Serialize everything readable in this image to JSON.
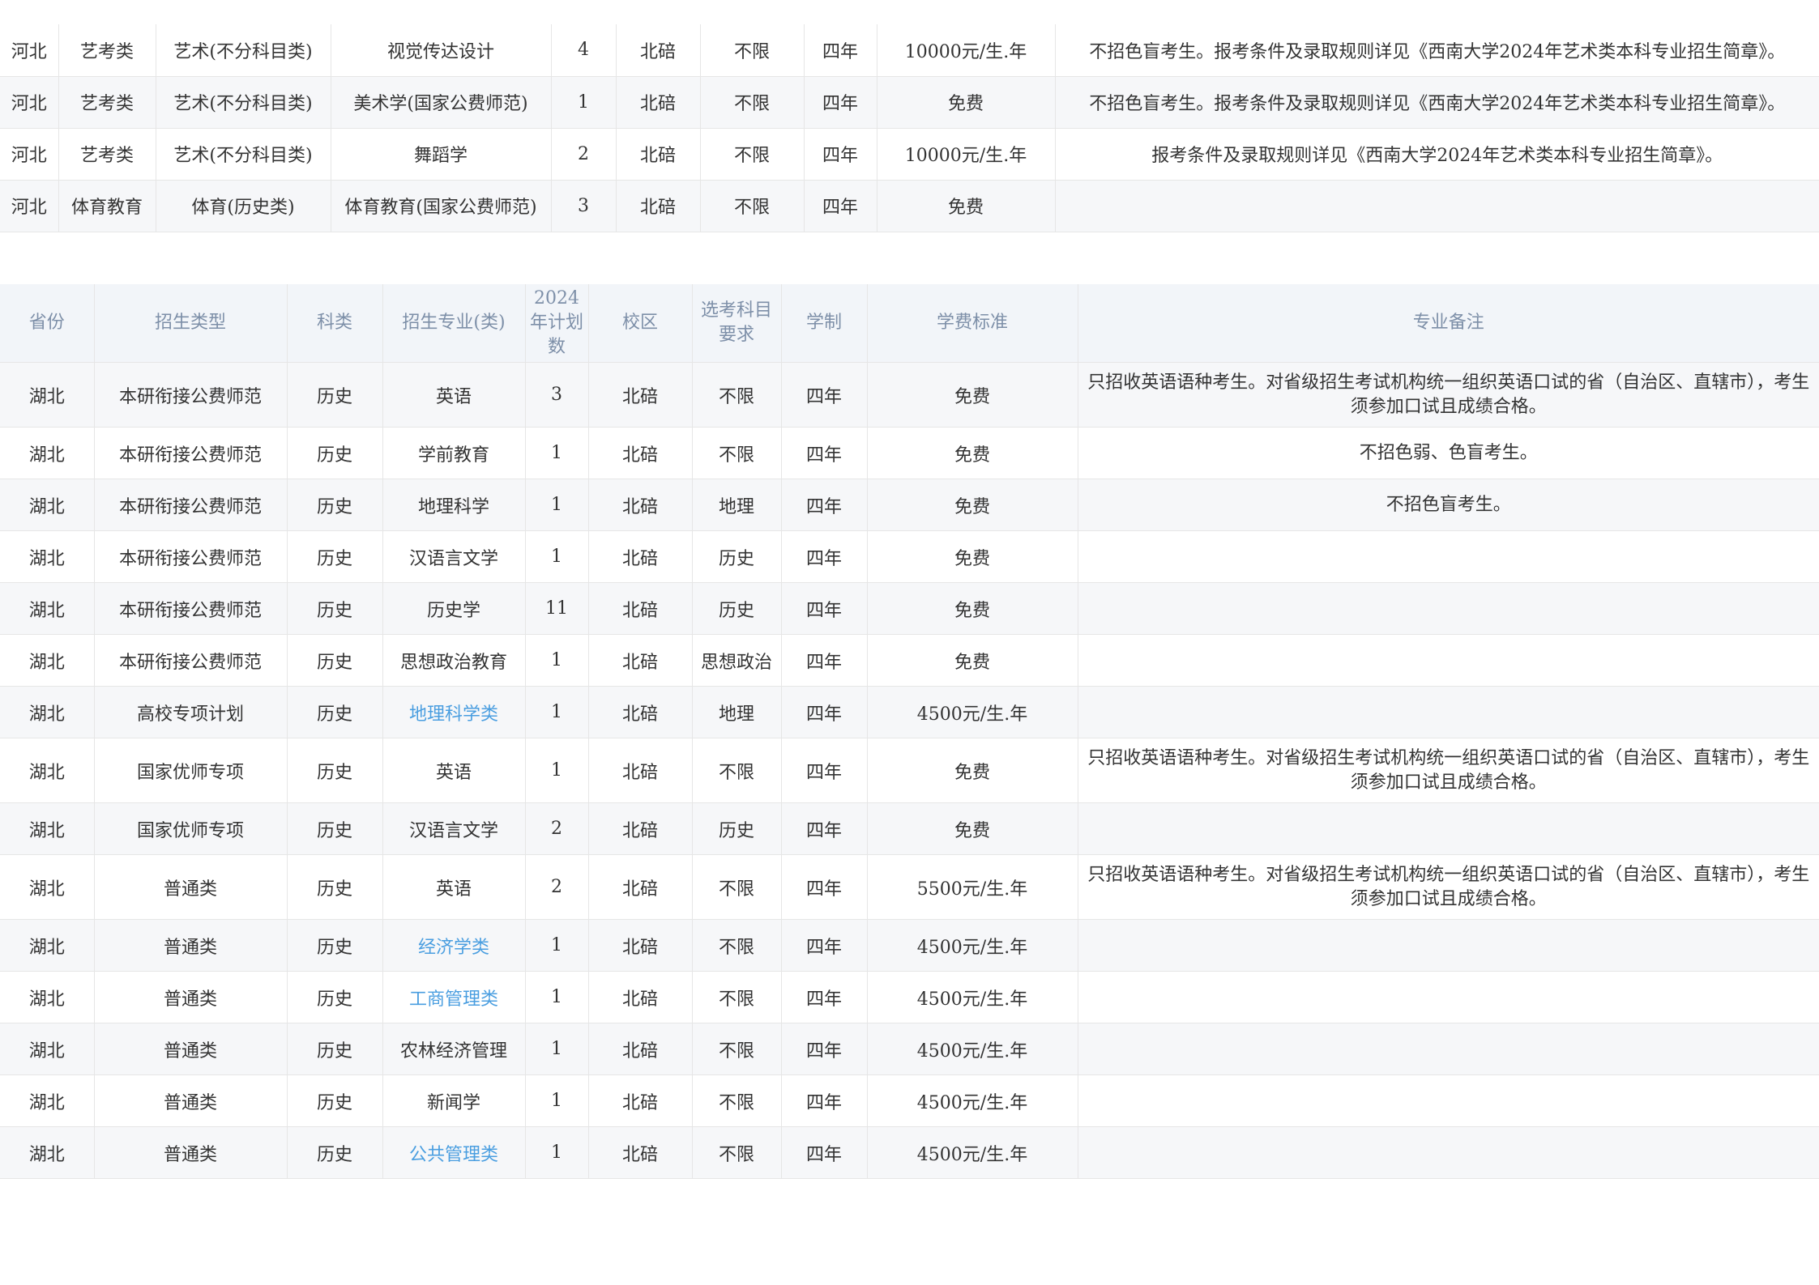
{
  "hebei_table": {
    "rows": [
      {
        "province": "河北",
        "type": "艺考类",
        "subject": "艺术(不分科目类)",
        "major": "视觉传达设计",
        "plan": "4",
        "campus": "北碚",
        "elective": "不限",
        "duration": "四年",
        "fee": "10000元/生.年",
        "note": "不招色盲考生。报考条件及录取规则详见《西南大学2024年艺术类本科专业招生简章》。"
      },
      {
        "province": "河北",
        "type": "艺考类",
        "subject": "艺术(不分科目类)",
        "major": "美术学(国家公费师范)",
        "plan": "1",
        "campus": "北碚",
        "elective": "不限",
        "duration": "四年",
        "fee": "免费",
        "note": "不招色盲考生。报考条件及录取规则详见《西南大学2024年艺术类本科专业招生简章》。"
      },
      {
        "province": "河北",
        "type": "艺考类",
        "subject": "艺术(不分科目类)",
        "major": "舞蹈学",
        "plan": "2",
        "campus": "北碚",
        "elective": "不限",
        "duration": "四年",
        "fee": "10000元/生.年",
        "note": "报考条件及录取规则详见《西南大学2024年艺术类本科专业招生简章》。"
      },
      {
        "province": "河北",
        "type": "体育教育",
        "subject": "体育(历史类)",
        "major": "体育教育(国家公费师范)",
        "plan": "3",
        "campus": "北碚",
        "elective": "不限",
        "duration": "四年",
        "fee": "免费",
        "note": ""
      }
    ]
  },
  "hubei_table": {
    "headers": {
      "province": "省份",
      "type": "招生类型",
      "subject": "科类",
      "major": "招生专业(类)",
      "plan": "2024年计划数",
      "campus": "校区",
      "elective": "选考科目要求",
      "duration": "学制",
      "fee": "学费标准",
      "note": "专业备注"
    },
    "rows": [
      {
        "province": "湖北",
        "type": "本研衔接公费师范",
        "subject": "历史",
        "major": "英语",
        "plan": "3",
        "campus": "北碚",
        "elective": "不限",
        "duration": "四年",
        "fee": "免费",
        "note": "只招收英语语种考生。对省级招生考试机构统一组织英语口试的省（自治区、直辖市），考生须参加口试且成绩合格。"
      },
      {
        "province": "湖北",
        "type": "本研衔接公费师范",
        "subject": "历史",
        "major": "学前教育",
        "plan": "1",
        "campus": "北碚",
        "elective": "不限",
        "duration": "四年",
        "fee": "免费",
        "note": "不招色弱、色盲考生。"
      },
      {
        "province": "湖北",
        "type": "本研衔接公费师范",
        "subject": "历史",
        "major": "地理科学",
        "plan": "1",
        "campus": "北碚",
        "elective": "地理",
        "duration": "四年",
        "fee": "免费",
        "note": "不招色盲考生。"
      },
      {
        "province": "湖北",
        "type": "本研衔接公费师范",
        "subject": "历史",
        "major": "汉语言文学",
        "plan": "1",
        "campus": "北碚",
        "elective": "历史",
        "duration": "四年",
        "fee": "免费",
        "note": ""
      },
      {
        "province": "湖北",
        "type": "本研衔接公费师范",
        "subject": "历史",
        "major": "历史学",
        "plan": "11",
        "campus": "北碚",
        "elective": "历史",
        "duration": "四年",
        "fee": "免费",
        "note": ""
      },
      {
        "province": "湖北",
        "type": "本研衔接公费师范",
        "subject": "历史",
        "major": "思想政治教育",
        "plan": "1",
        "campus": "北碚",
        "elective": "思想政治",
        "duration": "四年",
        "fee": "免费",
        "note": ""
      },
      {
        "province": "湖北",
        "type": "高校专项计划",
        "subject": "历史",
        "major": "地理科学类",
        "plan": "1",
        "campus": "北碚",
        "elective": "地理",
        "duration": "四年",
        "fee": "4500元/生.年",
        "note": ""
      },
      {
        "province": "湖北",
        "type": "国家优师专项",
        "subject": "历史",
        "major": "英语",
        "plan": "1",
        "campus": "北碚",
        "elective": "不限",
        "duration": "四年",
        "fee": "免费",
        "note": "只招收英语语种考生。对省级招生考试机构统一组织英语口试的省（自治区、直辖市），考生须参加口试且成绩合格。"
      },
      {
        "province": "湖北",
        "type": "国家优师专项",
        "subject": "历史",
        "major": "汉语言文学",
        "plan": "2",
        "campus": "北碚",
        "elective": "历史",
        "duration": "四年",
        "fee": "免费",
        "note": ""
      },
      {
        "province": "湖北",
        "type": "普通类",
        "subject": "历史",
        "major": "英语",
        "plan": "2",
        "campus": "北碚",
        "elective": "不限",
        "duration": "四年",
        "fee": "5500元/生.年",
        "note": "只招收英语语种考生。对省级招生考试机构统一组织英语口试的省（自治区、直辖市），考生须参加口试且成绩合格。"
      },
      {
        "province": "湖北",
        "type": "普通类",
        "subject": "历史",
        "major": "经济学类",
        "plan": "1",
        "campus": "北碚",
        "elective": "不限",
        "duration": "四年",
        "fee": "4500元/生.年",
        "note": ""
      },
      {
        "province": "湖北",
        "type": "普通类",
        "subject": "历史",
        "major": "工商管理类",
        "plan": "1",
        "campus": "北碚",
        "elective": "不限",
        "duration": "四年",
        "fee": "4500元/生.年",
        "note": ""
      },
      {
        "province": "湖北",
        "type": "普通类",
        "subject": "历史",
        "major": "农林经济管理",
        "plan": "1",
        "campus": "北碚",
        "elective": "不限",
        "duration": "四年",
        "fee": "4500元/生.年",
        "note": ""
      },
      {
        "province": "湖北",
        "type": "普通类",
        "subject": "历史",
        "major": "新闻学",
        "plan": "1",
        "campus": "北碚",
        "elective": "不限",
        "duration": "四年",
        "fee": "4500元/生.年",
        "note": ""
      },
      {
        "province": "湖北",
        "type": "普通类",
        "subject": "历史",
        "major": "公共管理类",
        "plan": "1",
        "campus": "北碚",
        "elective": "不限",
        "duration": "四年",
        "fee": "4500元/生.年",
        "note": ""
      }
    ]
  },
  "colors": {
    "header_bg": "#f2f5f9",
    "header_text": "#7d8fa8",
    "stripe_bg": "#f6f7f9",
    "link": "#4a9ee0"
  }
}
